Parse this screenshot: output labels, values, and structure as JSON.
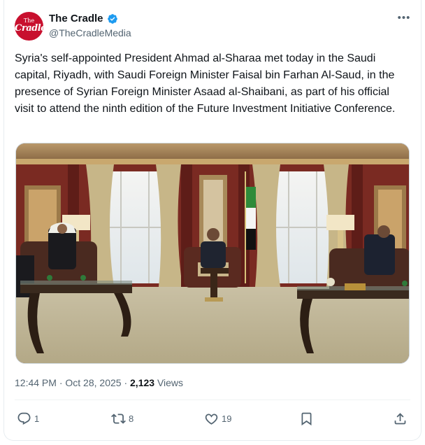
{
  "author": {
    "name": "The Cradle",
    "handle": "@TheCradleMedia",
    "avatar_text_top": "The",
    "avatar_text_main": "Cradle"
  },
  "more_label": "•••",
  "tweet": {
    "text": "Syria's self-appointed President Ahmad al-Sharaa met today in the Saudi capital, Riyadh, with Saudi Foreign Minister Faisal bin Farhan Al-Saud, in the presence of Syrian Foreign Minister Asaad al-Shaibani, as part of his official visit to attend the ninth edition of the Future Investment Initiative Conference."
  },
  "meta": {
    "time": "12:44 PM",
    "separator": "·",
    "date": "Oct 28, 2025",
    "views_count": "2,123",
    "views_label": "Views"
  },
  "actions": {
    "replies": "1",
    "reposts": "8",
    "likes": "19"
  },
  "colors": {
    "brand_red": "#c8102e",
    "verified_blue": "#1d9bf0",
    "secondary_text": "#536471"
  },
  "icons": [
    "verified-badge-icon",
    "more-icon",
    "reply-icon",
    "repost-icon",
    "like-icon",
    "bookmark-icon",
    "share-icon"
  ]
}
